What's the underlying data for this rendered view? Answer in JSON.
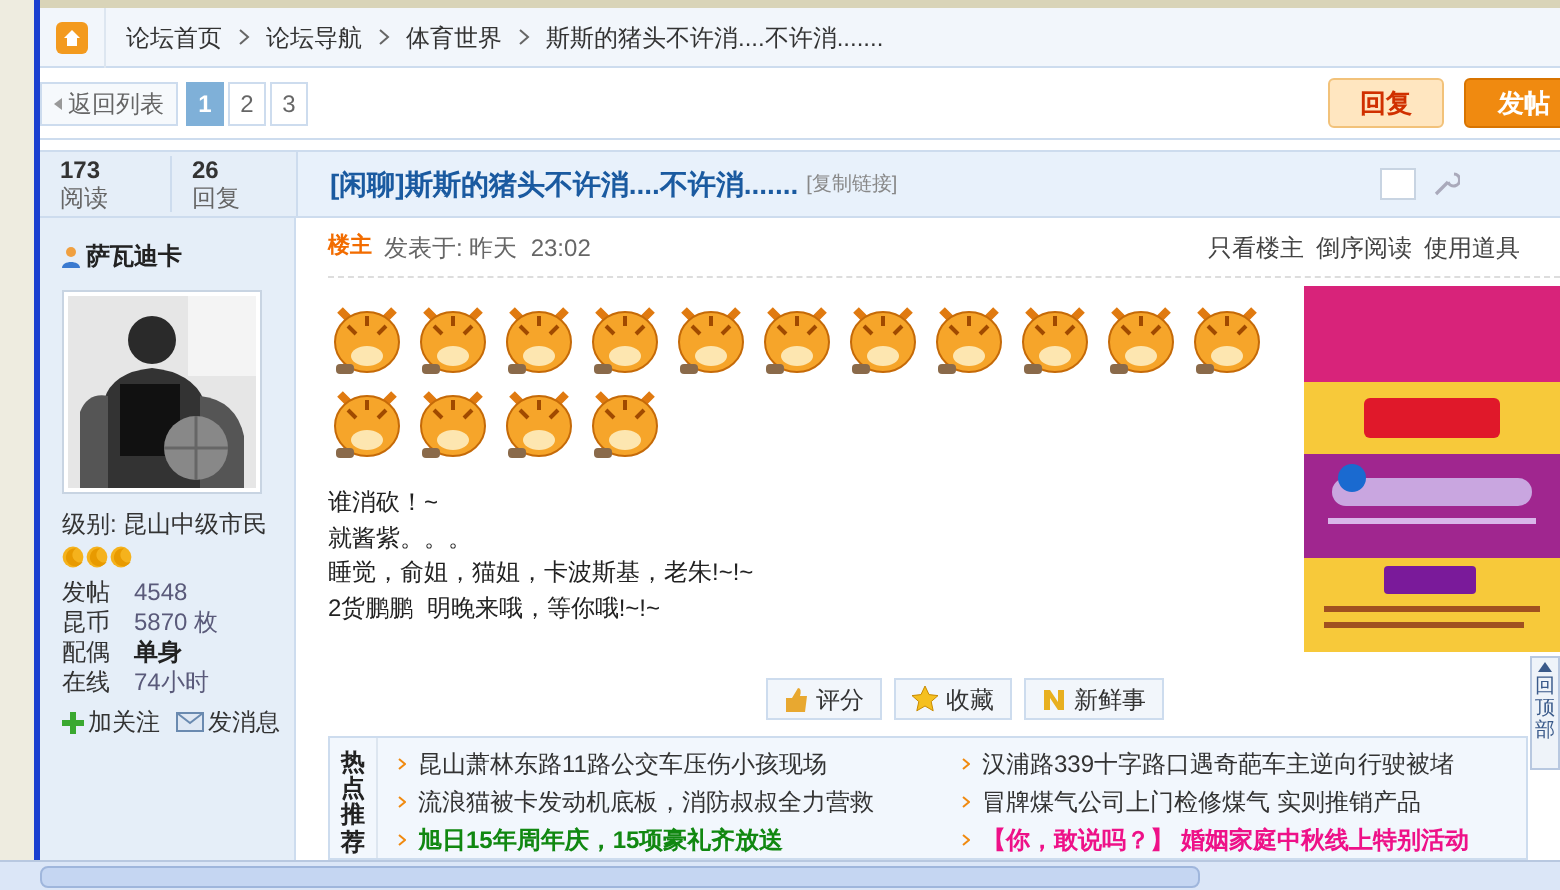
{
  "breadcrumb": [
    "论坛首页",
    "论坛导航",
    "体育世界",
    "斯斯的猪头不许消....不许消......."
  ],
  "back_button": "返回列表",
  "pages": [
    {
      "label": "1",
      "selected": true
    },
    {
      "label": "2",
      "selected": false
    },
    {
      "label": "3",
      "selected": false
    }
  ],
  "actions": [
    {
      "label": "回复",
      "kind": "secondary"
    },
    {
      "label": "发帖",
      "kind": "primary"
    }
  ],
  "stats": [
    {
      "value": "173",
      "label": "阅读"
    },
    {
      "value": "26",
      "label": "回复"
    }
  ],
  "thread": {
    "title": "[闲聊]斯斯的猪头不许消....不许消.......",
    "copy_link": "[复制链接]"
  },
  "author": {
    "name": "萨瓦迪卡",
    "level": "级别: 昆山中级市民",
    "stars": 3,
    "profile": [
      {
        "label": "发帖",
        "value": "4548"
      },
      {
        "label": "昆币",
        "value": "5870 枚"
      },
      {
        "label": "配偶",
        "value": "单身"
      },
      {
        "label": "在线",
        "value": "74小时"
      }
    ],
    "links": [
      "加关注",
      "发消息"
    ]
  },
  "post": {
    "floor": "楼主",
    "posted": "发表于: 昨天  23:02",
    "tools": [
      "只看楼主",
      "倒序阅读",
      "使用道具"
    ],
    "lines": [
      "谁消砍！~",
      "就酱紫。。。",
      "睡觉，俞姐，猫姐，卡波斯基，老朱!~!~",
      "2货鹏鹏  明晚来哦，等你哦!~!~"
    ],
    "buttons": [
      "评分",
      "收藏",
      "新鲜事"
    ]
  },
  "hot": {
    "title": "热点推荐",
    "items": [
      {
        "text": "昆山萧林东路11路公交车压伤小孩现场",
        "color": "#333333"
      },
      {
        "text": "汉浦路339十字路口遇奇葩车主逆向行驶被堵",
        "color": "#333333"
      },
      {
        "text": "流浪猫被卡发动机底板，消防叔叔全力营救",
        "color": "#333333"
      },
      {
        "text": "冒牌煤气公司上门检修煤气  实则推销产品",
        "color": "#333333"
      },
      {
        "text": "旭日15年周年庆，15项豪礼齐放送",
        "color": "#118811"
      },
      {
        "text": "【你，敢说吗？】  婚姻家庭中秋线上特别活动",
        "color": "#ee1188"
      }
    ]
  },
  "go_top": "回顶部"
}
